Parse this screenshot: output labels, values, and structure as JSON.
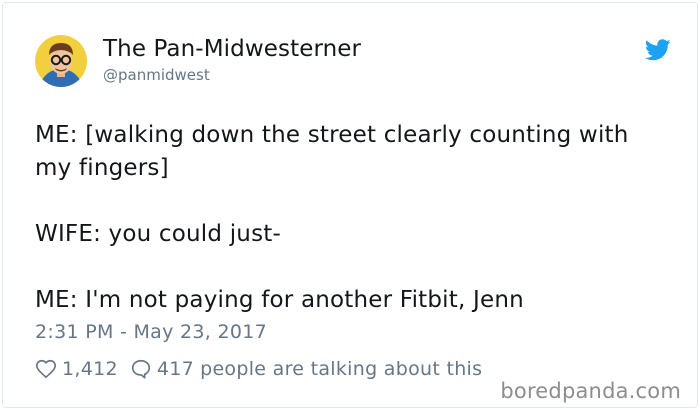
{
  "author": {
    "display_name": "The Pan-Midwesterner",
    "handle": "@panmidwest"
  },
  "tweet": {
    "line1": "ME: [walking down the street clearly counting with",
    "line2": "my fingers]",
    "line3": "WIFE: you could just-",
    "line4": "ME: I'm not paying for another Fitbit, Jenn",
    "timestamp": "2:31 PM - May 23, 2017"
  },
  "stats": {
    "likes": "1,412",
    "replies": "417",
    "talking_text": "people are talking about this"
  },
  "watermark": "boredpanda.com",
  "icons": {
    "brand": "twitter-bird-icon",
    "like": "heart-icon",
    "reply": "speech-bubble-icon"
  },
  "colors": {
    "twitter_blue": "#1da1f2",
    "text": "#14171a",
    "muted": "#657786"
  }
}
